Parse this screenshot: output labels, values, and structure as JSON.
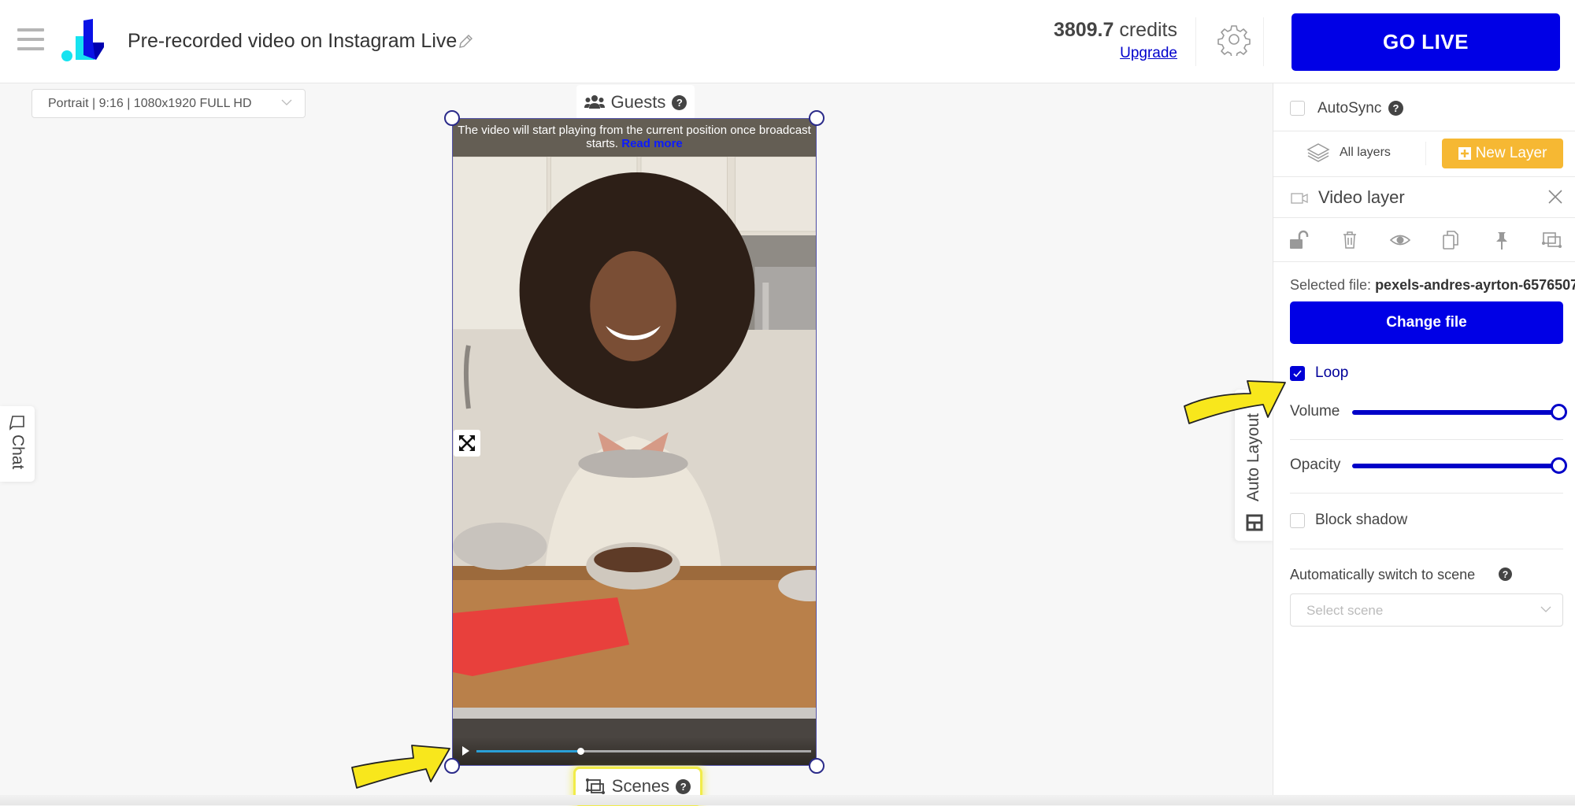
{
  "header": {
    "title": "Pre-recorded video on Instagram Live",
    "credits_amount": "3809.7",
    "credits_unit": " credits",
    "upgrade_label": "Upgrade",
    "go_live_label": "GO LIVE"
  },
  "canvas": {
    "format_select_value": "Portrait | 9:16 | 1080x1920 FULL HD",
    "guests_label": "Guests",
    "scenes_label": "Scenes",
    "video_notice": "The video will start playing from the current position once broadcast starts.",
    "read_more_label": "Read more",
    "playback_progress": 0.31,
    "chat_label": "Chat",
    "auto_layout_label": "Auto Layout"
  },
  "panel": {
    "autosync_label": "AutoSync",
    "autosync_checked": false,
    "all_layers_label": "All layers",
    "new_layer_label": "New Layer",
    "layer_title": "Video layer",
    "selected_file_label": "Selected file: ",
    "selected_file_name": "pexels-andres-ayrton-6576507",
    "change_file_label": "Change file",
    "loop_label": "Loop",
    "loop_checked": true,
    "volume_label": "Volume",
    "volume_value": 1.0,
    "opacity_label": "Opacity",
    "opacity_value": 1.0,
    "block_shadow_label": "Block shadow",
    "block_shadow_checked": false,
    "auto_switch_label": "Automatically switch to scene",
    "select_scene_placeholder": "Select scene"
  },
  "colors": {
    "primary": "#0000e6",
    "accent_orange": "#f6b833",
    "highlight_yellow": "#f1ec4a",
    "progress": "#2a9fd6"
  },
  "icons": [
    "menu-icon",
    "logo",
    "pencil-icon",
    "gear-icon",
    "chevron-down-icon",
    "guests-icon",
    "help-icon",
    "expand-icon",
    "play-icon",
    "scenes-icon",
    "chat-icon",
    "auto-layout-icon",
    "layers-icon",
    "plus-icon",
    "video-camera-icon",
    "close-icon",
    "unlock-icon",
    "trash-icon",
    "eye-icon",
    "copy-icon",
    "pin-icon",
    "resize-icon"
  ]
}
